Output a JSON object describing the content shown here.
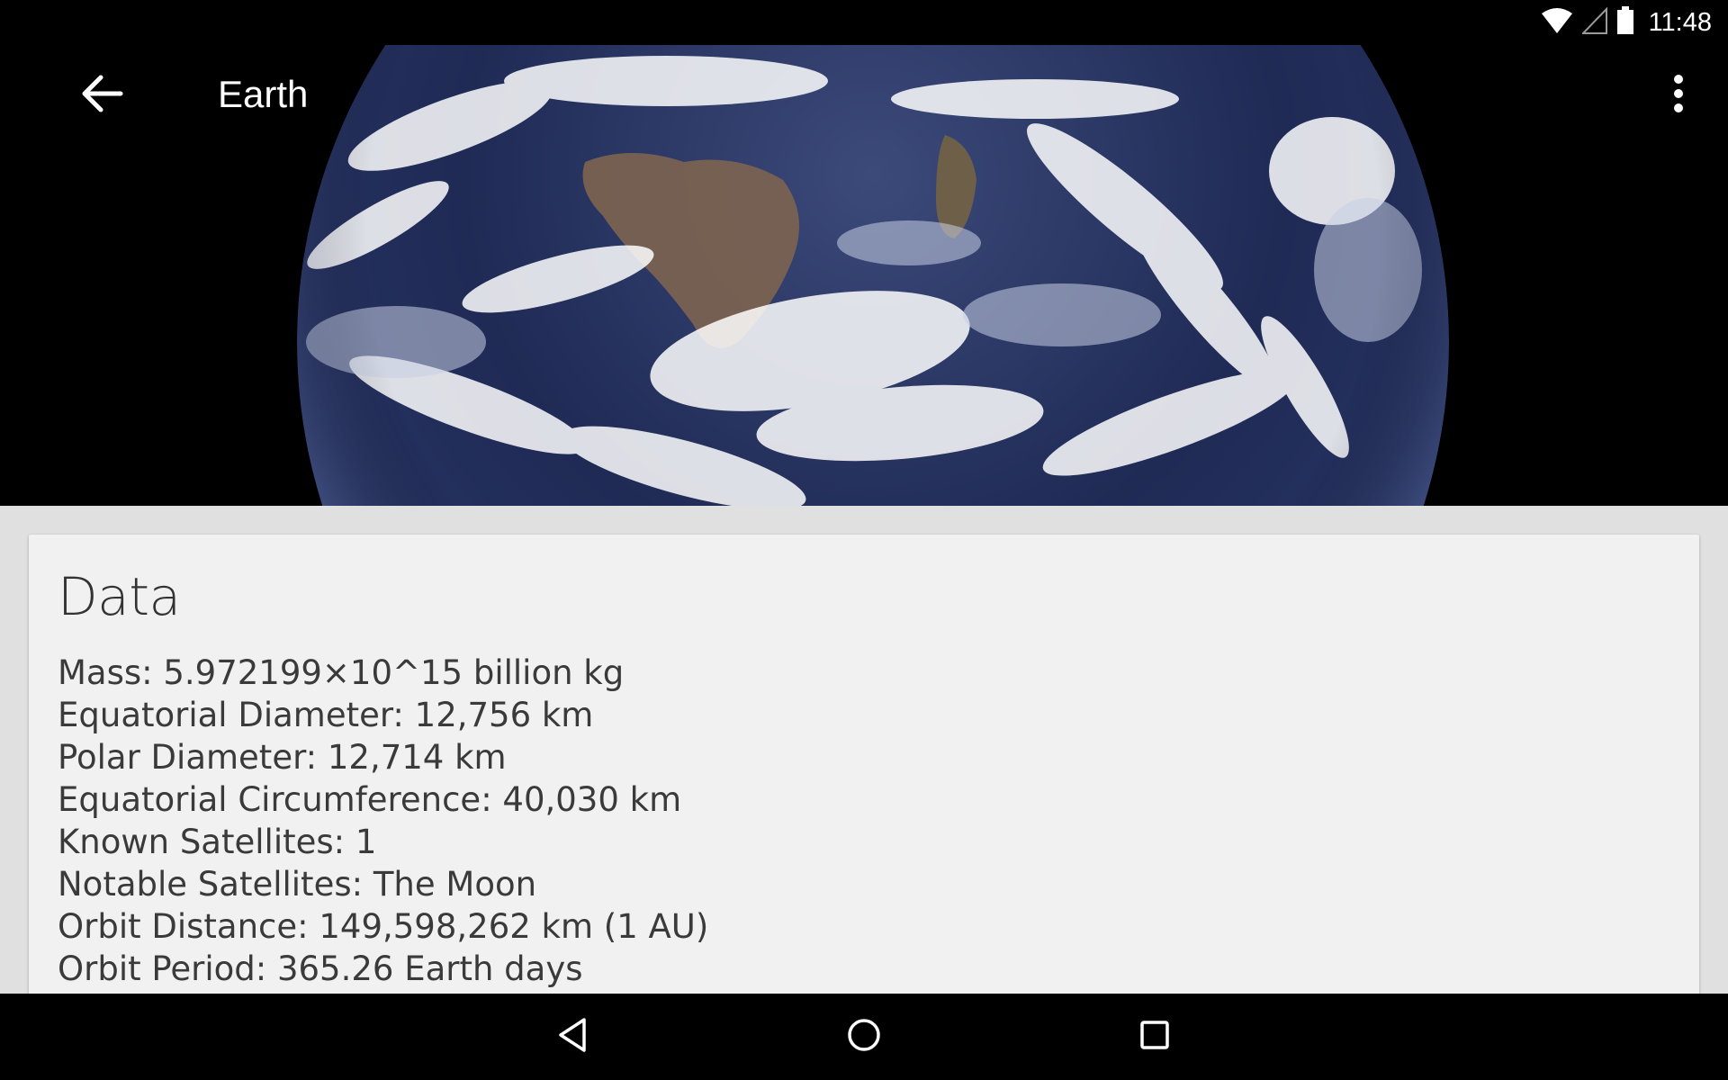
{
  "status_bar": {
    "time": "11:48",
    "icons": [
      "wifi-icon",
      "cell-signal-icon",
      "battery-icon"
    ]
  },
  "toolbar": {
    "title": "Earth",
    "back_icon": "arrow-back-icon",
    "overflow_icon": "more-vert-icon"
  },
  "hero": {
    "image": "earth-photo"
  },
  "card": {
    "title": "Data",
    "items": [
      "Mass: 5.972199×10^15 billion kg",
      "Equatorial Diameter: 12,756 km",
      "Polar Diameter: 12,714 km",
      "Equatorial Circumference: 40,030 km",
      "Known Satellites: 1",
      "Notable Satellites: The Moon",
      "Orbit Distance: 149,598,262 km (1 AU)",
      "Orbit Period: 365.26 Earth days"
    ]
  },
  "nav_bar": {
    "icons": [
      "nav-back-icon",
      "nav-home-icon",
      "nav-recents-icon"
    ]
  },
  "colors": {
    "status_bar": "#000000",
    "card_background": "#f1f1f1",
    "page_background": "#e0e0e0",
    "text": "#3a3a3a"
  }
}
